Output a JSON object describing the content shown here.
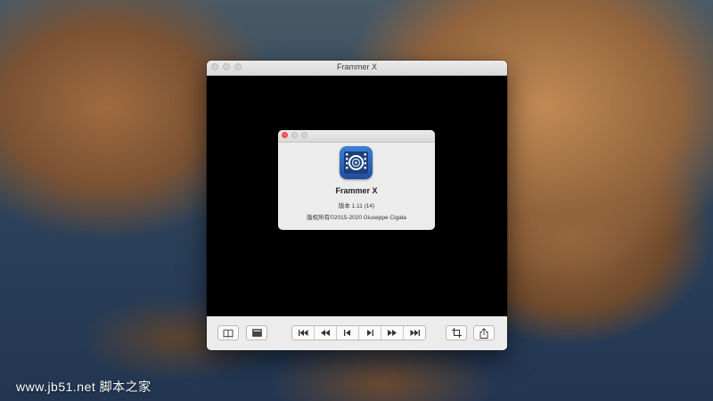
{
  "window": {
    "title": "Frammer X"
  },
  "about": {
    "app_name": "Frammer X",
    "version": "版本 1.11 (14)",
    "copyright": "版权所有©2015-2020 Giuseppe Cigala"
  },
  "toolbar": {
    "left_buttons": [
      {
        "icon": "book-icon"
      },
      {
        "icon": "film-icon"
      }
    ],
    "playback": [
      {
        "icon": "skip-to-start-icon",
        "glyph": "⏮"
      },
      {
        "icon": "rewind-icon",
        "glyph": "◀◀"
      },
      {
        "icon": "step-back-icon",
        "glyph": "◀▍"
      },
      {
        "icon": "step-forward-icon",
        "glyph": "▍▶"
      },
      {
        "icon": "fast-forward-icon",
        "glyph": "▶▶"
      },
      {
        "icon": "skip-to-end-icon",
        "glyph": "⏭"
      }
    ],
    "right_buttons": [
      {
        "icon": "crop-icon"
      },
      {
        "icon": "share-icon"
      }
    ]
  },
  "watermark": "www.jb51.net 脚本之家",
  "colors": {
    "close_red": "#ff5f57",
    "icon_blue": "#2f66bd"
  }
}
